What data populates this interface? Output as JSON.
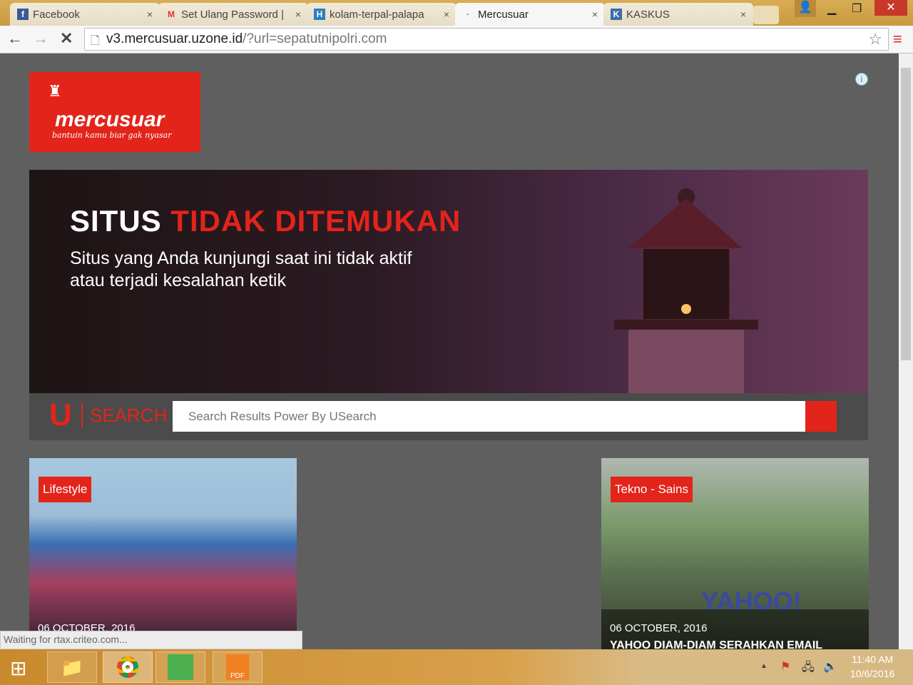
{
  "browser": {
    "tabs": [
      {
        "title": "Facebook",
        "icon": "facebook-icon",
        "active": false
      },
      {
        "title": "Set Ulang Password |",
        "icon": "gmail-icon",
        "active": false
      },
      {
        "title": "kolam-terpal-palapa",
        "icon": "h-icon",
        "active": false
      },
      {
        "title": "Mercusuar",
        "icon": "loading-icon",
        "active": true
      },
      {
        "title": "KASKUS",
        "icon": "kaskus-icon",
        "active": false
      }
    ],
    "close": "×",
    "url_host": "v3.mercusuar.uzone.id",
    "url_rest": "/?url=sepatutnipolri.com",
    "status": "Waiting for rtax.criteo.com..."
  },
  "logo": {
    "name": "mercusuar",
    "tagline": "bantuin kamu biar gak nyasar"
  },
  "banner": {
    "title_white": "SITUS",
    "title_red": "TIDAK DITEMUKAN",
    "line1": "Situs yang Anda kunjungi saat ini tidak aktif",
    "line2": "atau terjadi kesalahan ketik"
  },
  "search": {
    "brand_u": "U",
    "brand_text": "SEARCH",
    "placeholder": "Search Results Power By USearch"
  },
  "cards": [
    {
      "category": "Lifestyle",
      "date": "06 OCTOBER, 2016",
      "title": ""
    },
    {
      "category": "Tekno - Sains",
      "date": "06 OCTOBER, 2016",
      "title": "YAHOO DIAM-DIAM SERAHKAN EMAIL"
    }
  ],
  "taskbar": {
    "time": "11:40 AM",
    "date": "10/6/2016"
  },
  "colors": {
    "brand_red": "#e3241b",
    "page_bg": "#5f5f5f"
  }
}
